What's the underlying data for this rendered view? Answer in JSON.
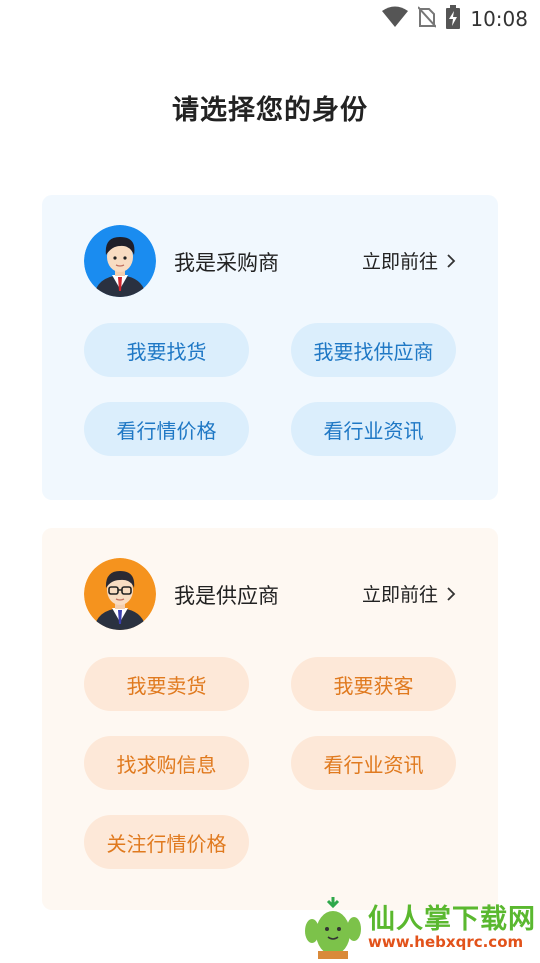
{
  "status_bar": {
    "time": "10:08",
    "icons": [
      "wifi-icon",
      "no-sim-icon",
      "battery-charging-icon"
    ]
  },
  "page": {
    "title": "请选择您的身份"
  },
  "buyer_card": {
    "role_label": "我是采购商",
    "goto_label": "立即前往",
    "options": [
      "我要找货",
      "我要找供应商",
      "看行情价格",
      "看行业资讯"
    ]
  },
  "supplier_card": {
    "role_label": "我是供应商",
    "goto_label": "立即前往",
    "options": [
      "我要卖货",
      "我要获客",
      "找求购信息",
      "看行业资讯",
      "关注行情价格"
    ]
  },
  "watermark": {
    "name": "仙人掌下载网",
    "url": "www.hebxqrc.com"
  },
  "colors": {
    "buyer_card_bg": "#f1f8fe",
    "buyer_pill_bg": "#dbeefc",
    "buyer_pill_text": "#1f78c5",
    "supplier_card_bg": "#fef8f2",
    "supplier_pill_bg": "#fde8d8",
    "supplier_pill_text": "#e07a1f",
    "buyer_avatar_bg": "#1a8cf0",
    "supplier_avatar_bg": "#f5931e"
  }
}
